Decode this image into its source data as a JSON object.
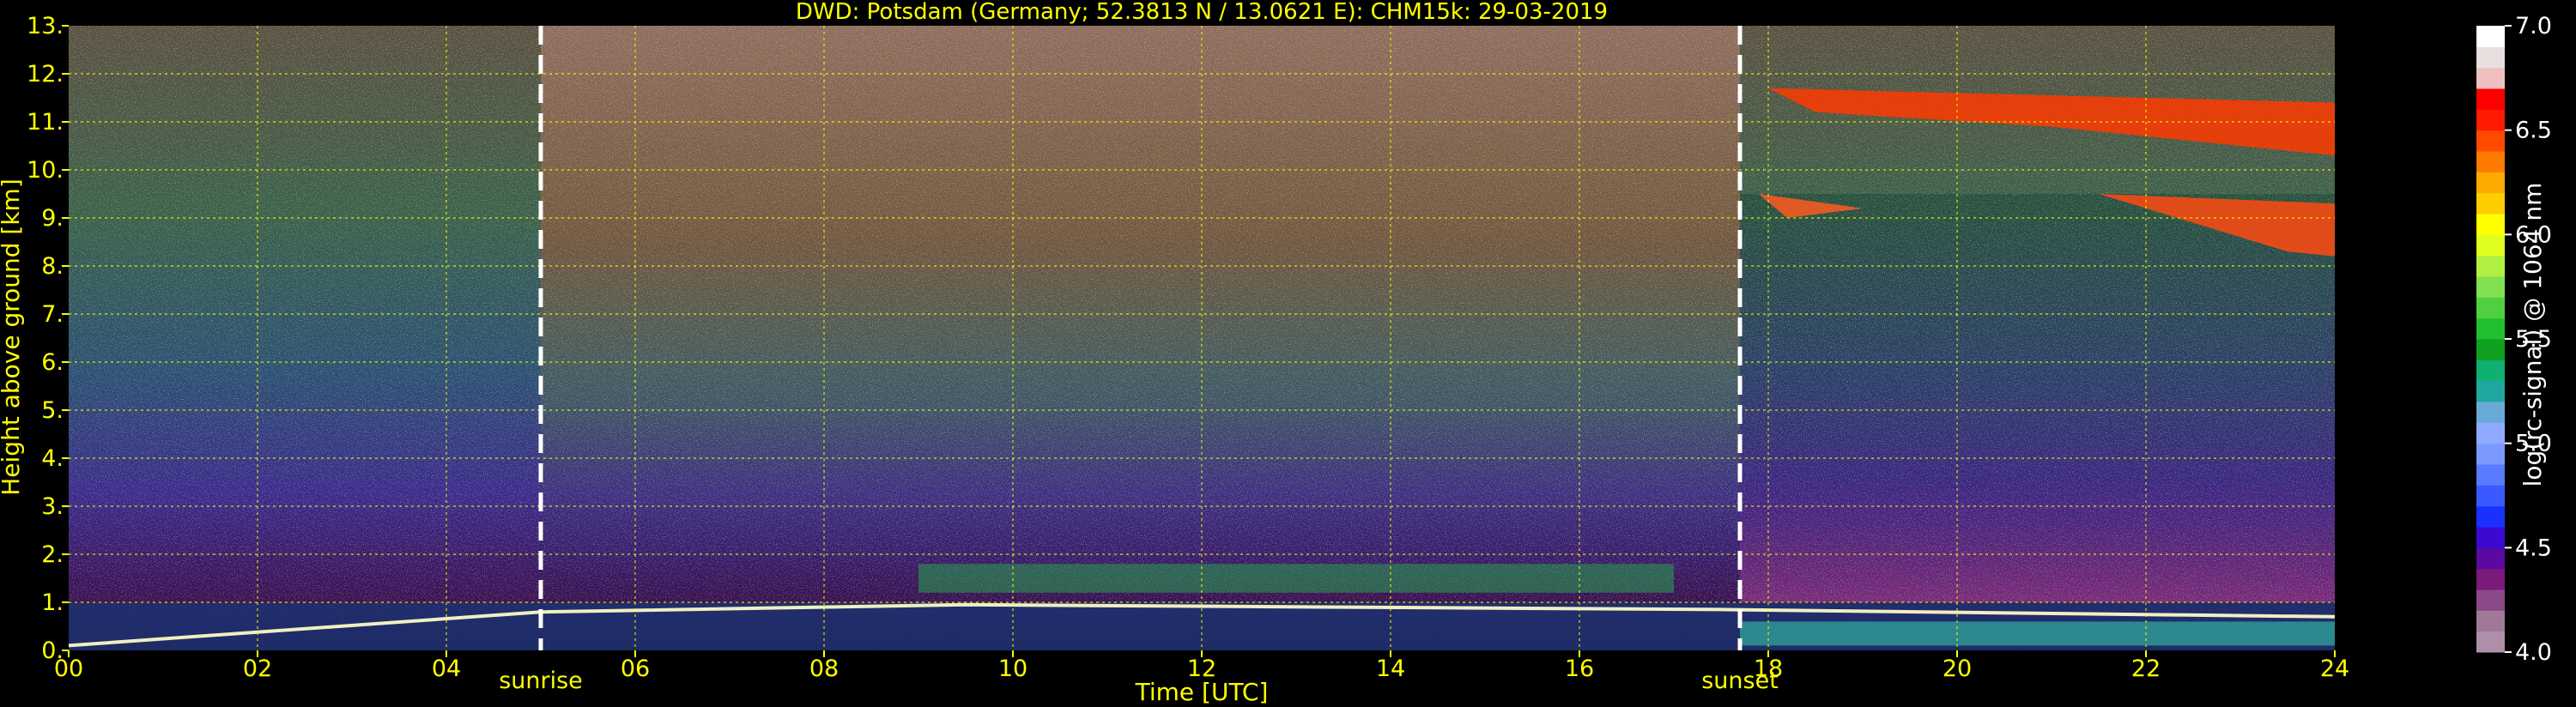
{
  "chart_data": {
    "type": "heatmap",
    "title": "DWD: Potsdam (Germany; 52.3813 N / 13.0621 E):    CHM15k: 29-03-2019",
    "xlabel": "Time [UTC]",
    "ylabel": "Height above ground [km]",
    "xlim": [
      0,
      24
    ],
    "ylim": [
      0,
      13
    ],
    "x_ticks": [
      "00",
      "02",
      "04",
      "06",
      "08",
      "10",
      "12",
      "14",
      "16",
      "18",
      "20",
      "22",
      "24"
    ],
    "y_ticks": [
      "0.",
      "1.",
      "2.",
      "3.",
      "4.",
      "5.",
      "6.",
      "7.",
      "8.",
      "9.",
      "10.",
      "11.",
      "12.",
      "13."
    ],
    "grid": true,
    "annotations": [
      {
        "label": "sunrise",
        "time": 5.0
      },
      {
        "label": "sunset",
        "time": 17.7
      }
    ],
    "colorbar": {
      "label": "log(rc-signal) @ 1064 nm",
      "range": [
        4.0,
        7.0
      ],
      "ticks": [
        "4.0",
        "4.5",
        "5.0",
        "5.5",
        "6.0",
        "6.5",
        "7.0"
      ],
      "colors": [
        "#b090a8",
        "#a07898",
        "#8a4a8a",
        "#7a1a7a",
        "#5a0aa0",
        "#3a0ad0",
        "#1a30ff",
        "#3a5aff",
        "#5a7aff",
        "#7a9aff",
        "#90aaff",
        "#6aaad8",
        "#20a8a0",
        "#10b070",
        "#10a020",
        "#20c030",
        "#50d040",
        "#80e050",
        "#b0f040",
        "#e0ff20",
        "#ffff00",
        "#ffcc00",
        "#ffaa00",
        "#ff7a00",
        "#ff4a00",
        "#ff1a00",
        "#ff0000",
        "#f0c0c0",
        "#e8e0e0",
        "#ffffff"
      ]
    }
  }
}
